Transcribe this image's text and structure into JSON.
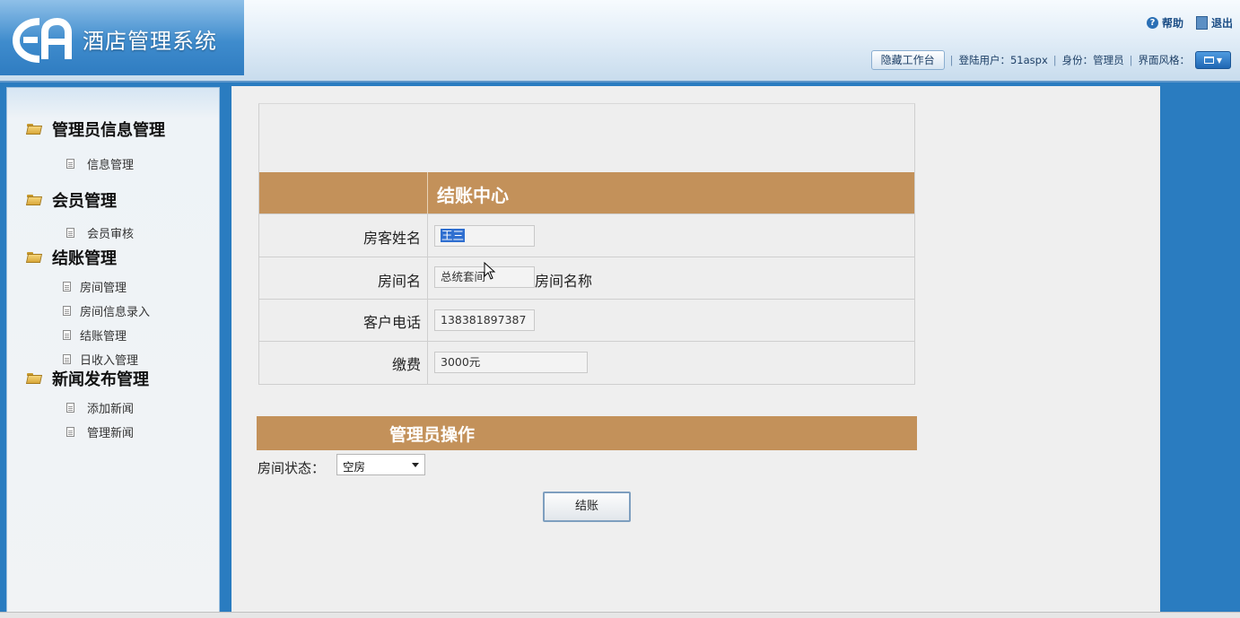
{
  "app": {
    "title": "酒店管理系统"
  },
  "top_links": {
    "help": "帮助",
    "logout": "退出"
  },
  "status_bar": {
    "hide_button": "隐藏工作台",
    "sep": "|",
    "login_user": "登陆用户：51aspx",
    "role": "身份：管理员",
    "skin": "界面风格："
  },
  "sidebar": {
    "groups": [
      {
        "title": "管理员信息管理",
        "items": [
          "信息管理"
        ]
      },
      {
        "title": "会员管理",
        "items": [
          "会员审核"
        ]
      },
      {
        "title": "结账管理",
        "items": [
          "房间管理",
          "房间信息录入",
          "结账管理",
          "日收入管理"
        ]
      },
      {
        "title": "新闻发布管理",
        "items": [
          "添加新闻",
          "管理新闻"
        ]
      }
    ]
  },
  "checkout": {
    "title": "结账中心",
    "fields": {
      "guest_name": {
        "label": "房客姓名",
        "value": "王三"
      },
      "room_name": {
        "label": "房间名",
        "value": "总统套间",
        "suffix": "房间名称"
      },
      "phone": {
        "label": "客户电话",
        "value": "138381897387"
      },
      "payment": {
        "label": "缴费",
        "value": "3000元"
      }
    }
  },
  "admin_ops": {
    "title": "管理员操作",
    "status_label": "房间状态：",
    "status_value": "空房",
    "submit_label": "结账"
  },
  "icons": [
    "logo-icon",
    "help-icon",
    "logout-icon",
    "skin-icon",
    "folder-icon",
    "page-icon",
    "dropdown-caret-icon",
    "mouse-cursor-icon"
  ]
}
